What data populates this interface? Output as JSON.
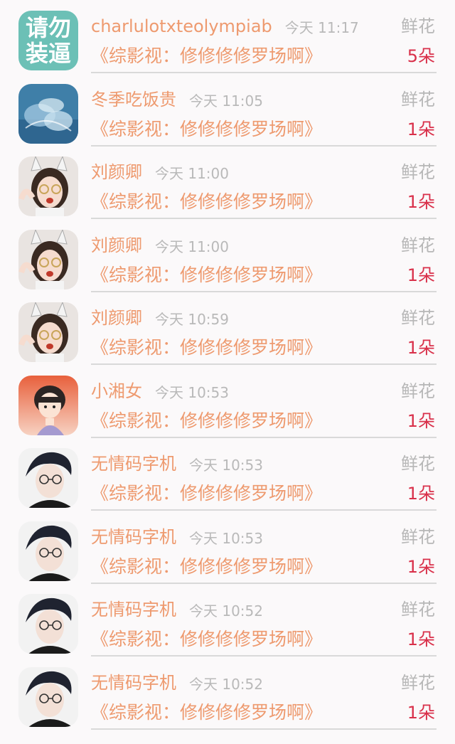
{
  "gift_list": [
    {
      "avatar": "text-avatar",
      "avatar_text": [
        "请勿",
        "装逼"
      ],
      "name": "charlulotxteolympiab",
      "time": "今天 11:17",
      "gift_type": "鲜花",
      "book": "《综影视：修修修修罗场啊》",
      "count": "5朵"
    },
    {
      "avatar": "ice-avatar",
      "name": "冬季吃饭贵",
      "time": "今天 11:05",
      "gift_type": "鲜花",
      "book": "《综影视：修修修修罗场啊》",
      "count": "1朵"
    },
    {
      "avatar": "girl-avatar",
      "name": "刘颜卿",
      "time": "今天 11:00",
      "gift_type": "鲜花",
      "book": "《综影视：修修修修罗场啊》",
      "count": "1朵"
    },
    {
      "avatar": "girl-avatar",
      "name": "刘颜卿",
      "time": "今天 11:00",
      "gift_type": "鲜花",
      "book": "《综影视：修修修修罗场啊》",
      "count": "1朵"
    },
    {
      "avatar": "girl-avatar",
      "name": "刘颜卿",
      "time": "今天 10:59",
      "gift_type": "鲜花",
      "book": "《综影视：修修修修罗场啊》",
      "count": "1朵"
    },
    {
      "avatar": "cartoon-boy-avatar",
      "name": "小湘女",
      "time": "今天 10:53",
      "gift_type": "鲜花",
      "book": "《综影视：修修修修罗场啊》",
      "count": "1朵"
    },
    {
      "avatar": "man-glasses-avatar",
      "name": "无情码字机",
      "time": "今天 10:53",
      "gift_type": "鲜花",
      "book": "《综影视：修修修修罗场啊》",
      "count": "1朵"
    },
    {
      "avatar": "man-glasses-avatar",
      "name": "无情码字机",
      "time": "今天 10:53",
      "gift_type": "鲜花",
      "book": "《综影视：修修修修罗场啊》",
      "count": "1朵"
    },
    {
      "avatar": "man-glasses-avatar",
      "name": "无情码字机",
      "time": "今天 10:52",
      "gift_type": "鲜花",
      "book": "《综影视：修修修修罗场啊》",
      "count": "1朵"
    },
    {
      "avatar": "man-glasses-avatar",
      "name": "无情码字机",
      "time": "今天 10:52",
      "gift_type": "鲜花",
      "book": "《综影视：修修修修罗场啊》",
      "count": "1朵"
    }
  ]
}
